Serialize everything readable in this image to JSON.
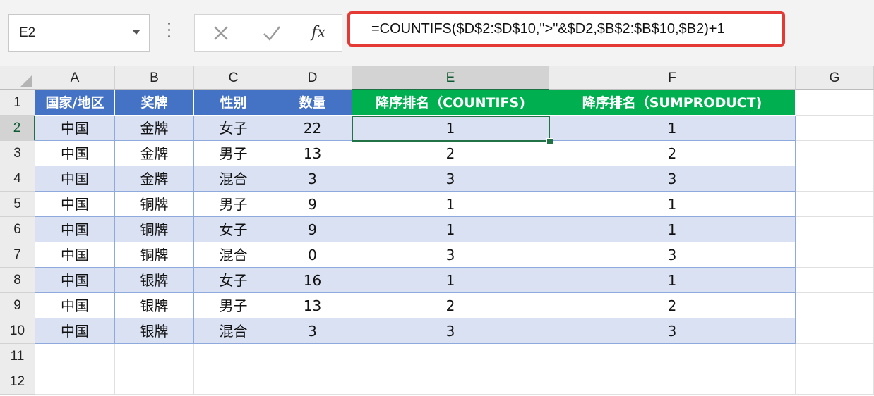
{
  "name_box": {
    "value": "E2"
  },
  "formula_bar": {
    "cancel_icon": "x-icon",
    "enter_icon": "check-icon",
    "fx_label": "fx",
    "formula": "=COUNTIFS($D$2:$D$10,\">\"&$D2,$B$2:$B$10,$B2)+1"
  },
  "columns": [
    "A",
    "B",
    "C",
    "D",
    "E",
    "F",
    "G"
  ],
  "rows": [
    "1",
    "2",
    "3",
    "4",
    "5",
    "6",
    "7",
    "8",
    "9",
    "10",
    "11",
    "12"
  ],
  "header_row": [
    "国家/地区",
    "奖牌",
    "性别",
    "数量",
    "降序排名（COUNTIFS)",
    "降序排名（SUMPRODUCT)"
  ],
  "data_rows": [
    [
      "中国",
      "金牌",
      "女子",
      "22",
      "1",
      "1"
    ],
    [
      "中国",
      "金牌",
      "男子",
      "13",
      "2",
      "2"
    ],
    [
      "中国",
      "金牌",
      "混合",
      "3",
      "3",
      "3"
    ],
    [
      "中国",
      "铜牌",
      "男子",
      "9",
      "1",
      "1"
    ],
    [
      "中国",
      "铜牌",
      "女子",
      "9",
      "1",
      "1"
    ],
    [
      "中国",
      "铜牌",
      "混合",
      "0",
      "3",
      "3"
    ],
    [
      "中国",
      "银牌",
      "女子",
      "16",
      "1",
      "1"
    ],
    [
      "中国",
      "银牌",
      "男子",
      "13",
      "2",
      "2"
    ],
    [
      "中国",
      "银牌",
      "混合",
      "3",
      "3",
      "3"
    ]
  ],
  "colors": {
    "header_blue": "#4472c4",
    "header_green": "#00b050",
    "band": "#d9e1f2",
    "highlight_border": "#e53935",
    "selection": "#217346"
  }
}
